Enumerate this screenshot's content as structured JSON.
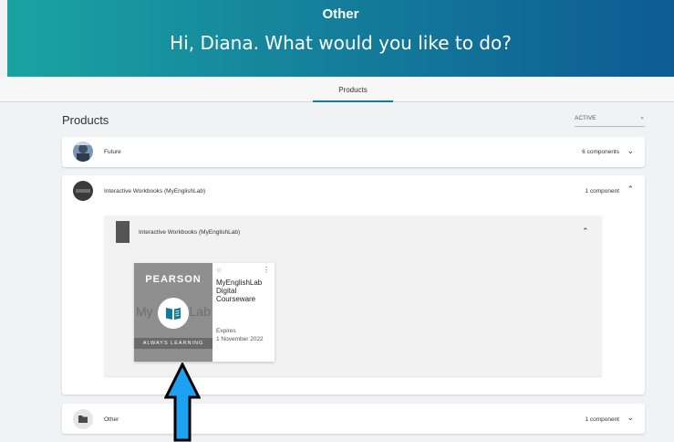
{
  "header": {
    "top_title": "Other",
    "greeting": "Hi, Diana. What would you like to do?"
  },
  "tabs": [
    {
      "label": "Products",
      "active": true
    }
  ],
  "page": {
    "title": "Products",
    "filter": {
      "value": "ACTIVE"
    }
  },
  "products": [
    {
      "name": "Future",
      "count": "6 components",
      "expanded": false
    },
    {
      "name": "Interactive Workbooks (MyEnglishLab)",
      "count": "1 component",
      "expanded": true,
      "inner": {
        "name": "Interactive Workbooks (MyEnglishLab)",
        "card": {
          "brand": "PEARSON",
          "cover_left": "My",
          "cover_right": "Lab",
          "cover_strip": "ALWAYS LEARNING",
          "title": "MyEnglishLab Digital Courseware",
          "expires_label": "Expires",
          "expires_date": "1 November 2022"
        }
      }
    },
    {
      "name": "Other",
      "count": "1 component",
      "expanded": false
    }
  ],
  "colors": {
    "header_start": "#1aa3a2",
    "header_end": "#0d5b93",
    "accent": "#137a9a",
    "arrow_fill": "#1da1f2"
  }
}
